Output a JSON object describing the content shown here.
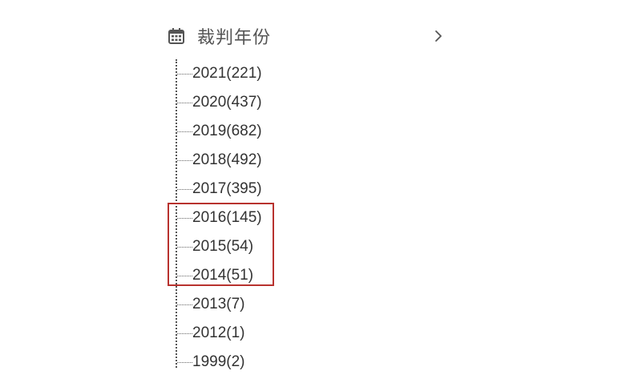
{
  "header": {
    "title": "裁判年份",
    "icon": "calendar-icon",
    "expand_icon": "chevron-right-icon"
  },
  "years": [
    {
      "label": "2021(221)"
    },
    {
      "label": "2020(437)"
    },
    {
      "label": "2019(682)"
    },
    {
      "label": "2018(492)"
    },
    {
      "label": "2017(395)"
    },
    {
      "label": "2016(145)"
    },
    {
      "label": "2015(54)"
    },
    {
      "label": "2014(51)"
    },
    {
      "label": "2013(7)"
    },
    {
      "label": "2012(1)"
    },
    {
      "label": "1999(2)"
    }
  ],
  "highlight": {
    "color": "#b8322e"
  }
}
